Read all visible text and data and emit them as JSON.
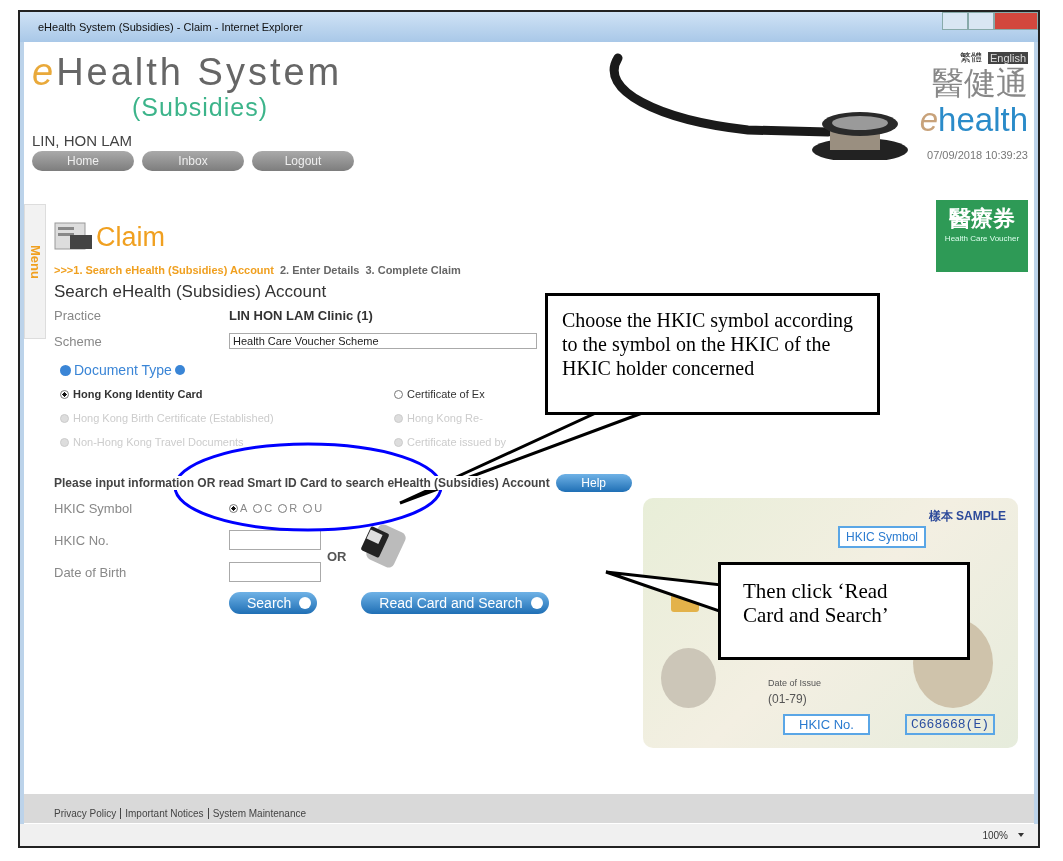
{
  "window": {
    "title": "eHealth System (Subsidies) - Claim - Internet Explorer"
  },
  "header": {
    "logo_title": "eHealth System",
    "logo_subtitle": "(Subsidies)",
    "user": "LIN, HON LAM",
    "nav": [
      "Home",
      "Inbox",
      "Logout"
    ],
    "languages": [
      {
        "label": "繁體",
        "selected": false
      },
      {
        "label": "English",
        "selected": true
      }
    ],
    "brand_chinese": "醫健通",
    "brand_english": "ehealth",
    "datetime": "07/09/2018 10:39:23"
  },
  "side_menu": {
    "label": "Menu"
  },
  "voucher_badge": {
    "title": "醫療券",
    "subtitle": "Health Care Voucher"
  },
  "heading": "Claim",
  "steps": [
    {
      "label": ">>>1. Search eHealth (Subsidies) Account",
      "selected": true
    },
    {
      "label": "2. Enter Details",
      "selected": false
    },
    {
      "label": "3. Complete Claim",
      "selected": false
    }
  ],
  "section_title": "Search eHealth (Subsidies) Account",
  "practice": {
    "label": "Practice",
    "value": "LIN HON LAM Clinic (1)"
  },
  "scheme": {
    "label": "Scheme",
    "value": "Health Care Voucher Scheme"
  },
  "document_type": {
    "label": "Document Type",
    "options": [
      {
        "label": "Hong Kong Identity Card",
        "selected": true,
        "disabled": false
      },
      {
        "label": "Certificate of Ex",
        "selected": false,
        "disabled": false
      },
      {
        "label": "Hong Kong Birth Certificate (Established)",
        "selected": false,
        "disabled": true
      },
      {
        "label": "Hong Kong Re-",
        "selected": false,
        "disabled": true
      },
      {
        "label": "Non-Hong Kong Travel Documents",
        "selected": false,
        "disabled": true
      },
      {
        "label": "Certificate issued by",
        "selected": false,
        "disabled": true
      }
    ]
  },
  "instruction": "Please input information OR read Smart ID Card to search eHealth (Subsidies) Account",
  "help_button": "Help",
  "hkic_symbol": {
    "label": "HKIC Symbol",
    "options": [
      {
        "label": "A",
        "selected": true
      },
      {
        "label": "C",
        "selected": false
      },
      {
        "label": "R",
        "selected": false
      },
      {
        "label": "U",
        "selected": false
      }
    ]
  },
  "hkic_no": {
    "label": "HKIC No."
  },
  "date_of_birth": {
    "label": "Date of Birth"
  },
  "or_text": "OR",
  "buttons": [
    "Search",
    "Read Card and Search"
  ],
  "sample_card": {
    "mark": "樣本 SAMPLE",
    "symbol_label": "HKIC Symbol",
    "issue_label": "Date of Issue",
    "issue_date": "(01-79)",
    "number_label": "HKIC No.",
    "number_value": "C668668(E)"
  },
  "footer_links": [
    "Privacy Policy",
    "Important Notices",
    "System Maintenance"
  ],
  "status_bar": {
    "zoom": "100%"
  },
  "callouts": [
    {
      "text": "Choose the HKIC symbol according to the symbol on the HKIC of the HKIC holder concerned"
    },
    {
      "text": "Then click ‘Read Card and Search’"
    }
  ]
}
